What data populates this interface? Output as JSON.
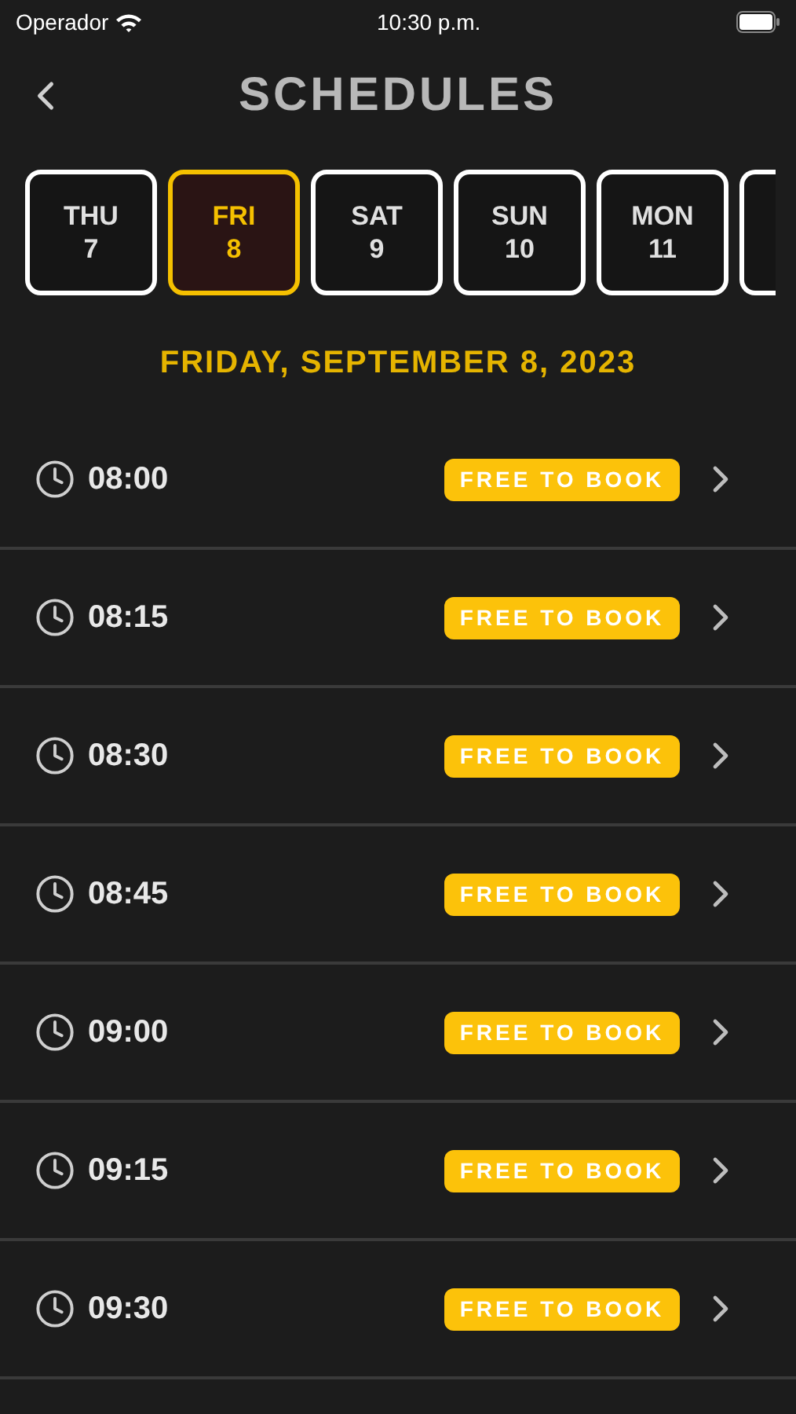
{
  "status_bar": {
    "carrier": "Operador",
    "time": "10:30 p.m."
  },
  "title": "SCHEDULES",
  "days": [
    {
      "weekday": "THU",
      "day": "7",
      "selected": false
    },
    {
      "weekday": "FRI",
      "day": "8",
      "selected": true
    },
    {
      "weekday": "SAT",
      "day": "9",
      "selected": false
    },
    {
      "weekday": "SUN",
      "day": "10",
      "selected": false
    },
    {
      "weekday": "MON",
      "day": "11",
      "selected": false
    }
  ],
  "date_heading": "FRIDAY, SEPTEMBER 8, 2023",
  "slots": [
    {
      "time": "08:00",
      "status": "FREE TO BOOK"
    },
    {
      "time": "08:15",
      "status": "FREE TO BOOK"
    },
    {
      "time": "08:30",
      "status": "FREE TO BOOK"
    },
    {
      "time": "08:45",
      "status": "FREE TO BOOK"
    },
    {
      "time": "09:00",
      "status": "FREE TO BOOK"
    },
    {
      "time": "09:15",
      "status": "FREE TO BOOK"
    },
    {
      "time": "09:30",
      "status": "FREE TO BOOK"
    }
  ]
}
